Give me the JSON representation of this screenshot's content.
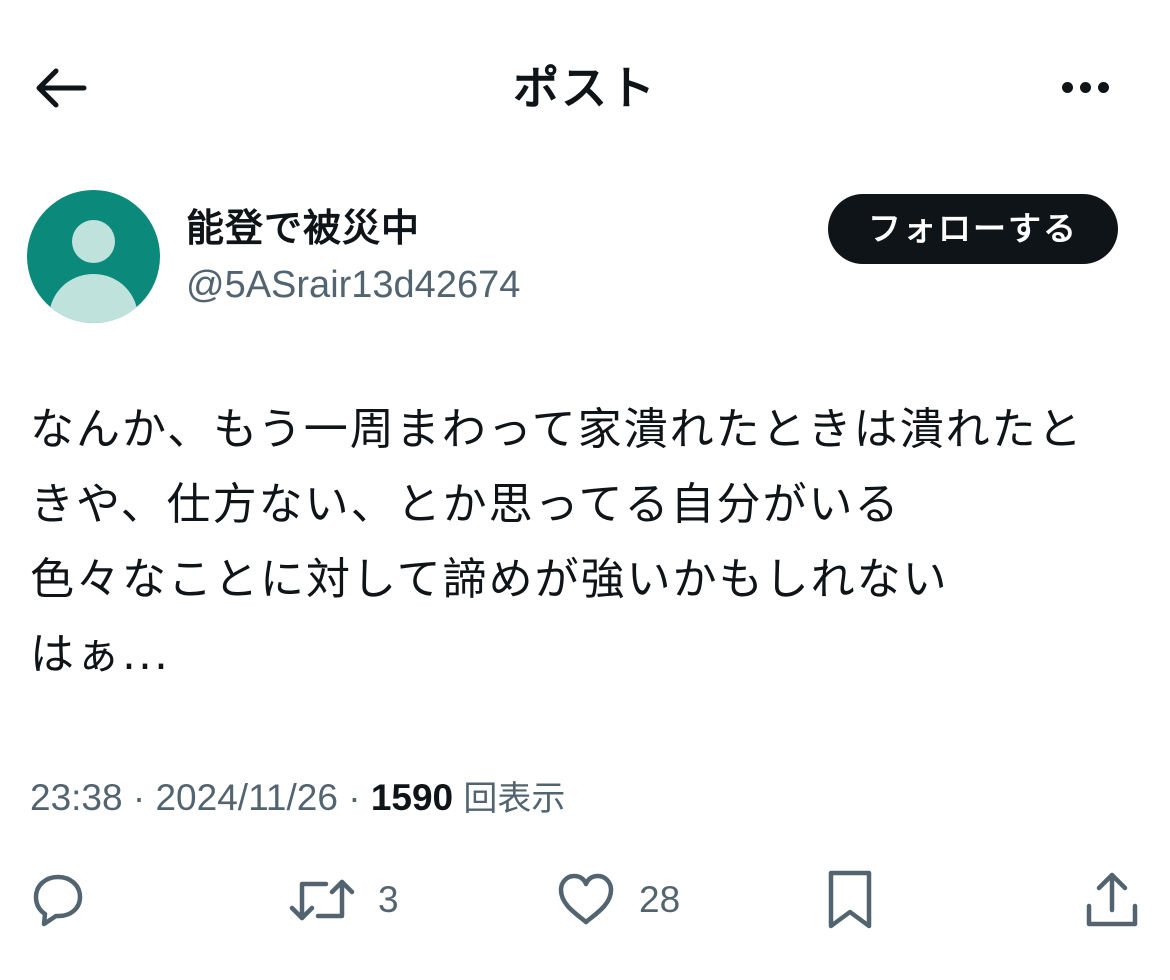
{
  "header": {
    "title": "ポスト"
  },
  "user": {
    "display_name": "能登で被災中",
    "handle": "@5ASrair13d42674",
    "follow_label": "フォローする"
  },
  "post": {
    "lines": [
      "なんか、もう一周まわって家潰れたときは潰れたと",
      "きや、仕方ない、とか思ってる自分がいる",
      "色々なことに対して諦めが強いかもしれない",
      "はぁ..."
    ]
  },
  "meta": {
    "time": "23:38",
    "date": "2024/11/26",
    "views_count": "1590",
    "views_label": "回表示",
    "separator": " · "
  },
  "actions": {
    "reply_count": "",
    "repost_count": "3",
    "like_count": "28"
  },
  "colors": {
    "avatar_bg": "#0b8a7c",
    "avatar_fg": "#bfe2dc",
    "secondary_text": "#536471",
    "primary_text": "#0f1419"
  }
}
